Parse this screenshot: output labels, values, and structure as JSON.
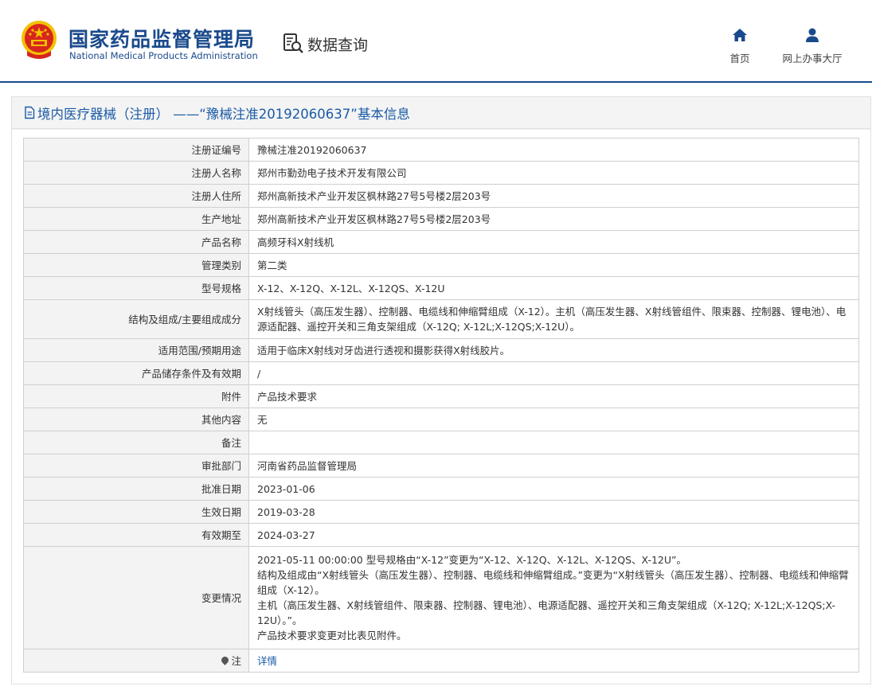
{
  "header": {
    "title_cn": "国家药品监督管理局",
    "title_en": "National Medical Products Administration",
    "query_label": "数据查询",
    "nav": {
      "home": "首页",
      "service_hall": "网上办事大厅"
    }
  },
  "panel": {
    "title": "境内医疗器械（注册） ——“豫械注准20192060637”基本信息"
  },
  "rows": [
    {
      "label": "注册证编号",
      "value": "豫械注准20192060637"
    },
    {
      "label": "注册人名称",
      "value": "郑州市勤劲电子技术开发有限公司"
    },
    {
      "label": "注册人住所",
      "value": "郑州高新技术产业开发区枫林路27号5号楼2层203号"
    },
    {
      "label": "生产地址",
      "value": "郑州高新技术产业开发区枫林路27号5号楼2层203号"
    },
    {
      "label": "产品名称",
      "value": "高频牙科X射线机"
    },
    {
      "label": "管理类别",
      "value": "第二类"
    },
    {
      "label": "型号规格",
      "value": "X-12、X-12Q、X-12L、X-12QS、X-12U"
    },
    {
      "label": "结构及组成/主要组成成分",
      "value": "X射线管头（高压发生器）、控制器、电缆线和伸缩臂组成（X-12）。主机（高压发生器、X射线管组件、限束器、控制器、锂电池）、电源适配器、遥控开关和三角支架组成（X-12Q; X-12L;X-12QS;X-12U）。"
    },
    {
      "label": "适用范围/预期用途",
      "value": "适用于临床X射线对牙齿进行透视和摄影获得X射线胶片。"
    },
    {
      "label": "产品储存条件及有效期",
      "value": "/"
    },
    {
      "label": "附件",
      "value": "产品技术要求"
    },
    {
      "label": "其他内容",
      "value": "无"
    },
    {
      "label": "备注",
      "value": ""
    },
    {
      "label": "审批部门",
      "value": "河南省药品监督管理局"
    },
    {
      "label": "批准日期",
      "value": "2023-01-06"
    },
    {
      "label": "生效日期",
      "value": "2019-03-28"
    },
    {
      "label": "有效期至",
      "value": "2024-03-27"
    },
    {
      "label": "变更情况",
      "lines": [
        "2021-05-11 00:00:00 型号规格由“X-12”变更为“X-12、X-12Q、X-12L、X-12QS、X-12U”。",
        "结构及组成由“X射线管头（高压发生器）、控制器、电缆线和伸缩臂组成。”变更为“X射线管头（高压发生器）、控制器、电缆线和伸缩臂组成（X-12）。",
        "主机（高压发生器、X射线管组件、限束器、控制器、锂电池）、电源适配器、遥控开关和三角支架组成（X-12Q; X-12L;X-12QS;X-12U）。”。",
        "产品技术要求变更对比表见附件。"
      ]
    },
    {
      "label": "注",
      "value": "详情"
    }
  ],
  "colors": {
    "brand_blue": "#1a4a8c",
    "link_blue": "#1a5ba6",
    "emblem_red": "#d7261e",
    "emblem_gold": "#f2c100"
  },
  "icons": [
    "national-emblem",
    "search-document-icon",
    "home-icon",
    "user-icon",
    "document-icon",
    "pin-icon"
  ]
}
